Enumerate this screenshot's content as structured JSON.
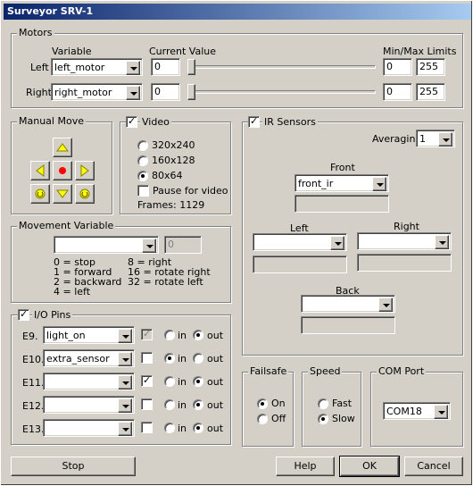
{
  "window": {
    "title": "Surveyor SRV-1"
  },
  "motors": {
    "label": "Motors",
    "col_variable": "Variable",
    "col_current": "Current Value",
    "col_limits": "Min/Max Limits",
    "rows": [
      {
        "name": "Left",
        "variable": "left_motor",
        "value": "0",
        "min": "0",
        "max": "255",
        "slider": 0
      },
      {
        "name": "Right",
        "variable": "right_motor",
        "value": "0",
        "min": "0",
        "max": "255",
        "slider": 0
      }
    ]
  },
  "manual_move": {
    "label": "Manual Move",
    "icons": [
      "arrow-up-icon",
      "arrow-left-icon",
      "stop-dot-icon",
      "arrow-right-icon",
      "rotate-left-icon",
      "arrow-down-icon",
      "rotate-right-icon"
    ]
  },
  "video": {
    "label": "Video",
    "checked": true,
    "options": [
      "320x240",
      "160x128",
      "80x64"
    ],
    "selected": "80x64",
    "pause_label": "Pause for video",
    "frames": "Frames: 1129"
  },
  "ir": {
    "label": "IR Sensors",
    "checked": true,
    "averaging_label": "Averaging",
    "averaging": "1",
    "front_label": "Front",
    "front": "front_ir",
    "left_label": "Left",
    "left": "",
    "right_label": "Right",
    "right": "",
    "back_label": "Back",
    "back": ""
  },
  "movement": {
    "label": "Movement Variable",
    "variable": "",
    "value": "0",
    "legend_left": [
      "0 = stop",
      "1 = forward",
      "2 = backward",
      "4 = left"
    ],
    "legend_right": [
      "8 = right",
      "16 = rotate right",
      "32 = rotate left"
    ]
  },
  "io": {
    "label": "I/O Pins",
    "checked": true,
    "in_label": "in",
    "out_label": "out",
    "pins": [
      {
        "pin": "E9.",
        "variable": "light_on",
        "checked": true,
        "disabled": true,
        "mode": "out"
      },
      {
        "pin": "E10.",
        "variable": "extra_sensor",
        "checked": false,
        "disabled": false,
        "mode": "in"
      },
      {
        "pin": "E11.",
        "variable": "",
        "checked": true,
        "disabled": false,
        "mode": "out"
      },
      {
        "pin": "E12.",
        "variable": "",
        "checked": false,
        "disabled": false,
        "mode": "out"
      },
      {
        "pin": "E13.",
        "variable": "",
        "checked": false,
        "disabled": false,
        "mode": "out"
      }
    ]
  },
  "failsafe": {
    "label": "Failsafe",
    "on": "On",
    "off": "Off",
    "selected": "On"
  },
  "speed": {
    "label": "Speed",
    "fast": "Fast",
    "slow": "Slow",
    "selected": "Slow"
  },
  "com": {
    "label": "COM Port",
    "value": "COM18"
  },
  "buttons": {
    "stop": "Stop",
    "help": "Help",
    "ok": "OK",
    "cancel": "Cancel"
  },
  "colors": {
    "title_start": "#0a246a",
    "title_end": "#a6caf0",
    "face": "#d4d0c8",
    "arrow_yellow": "#ffff00",
    "stop_red": "#ff0000"
  }
}
